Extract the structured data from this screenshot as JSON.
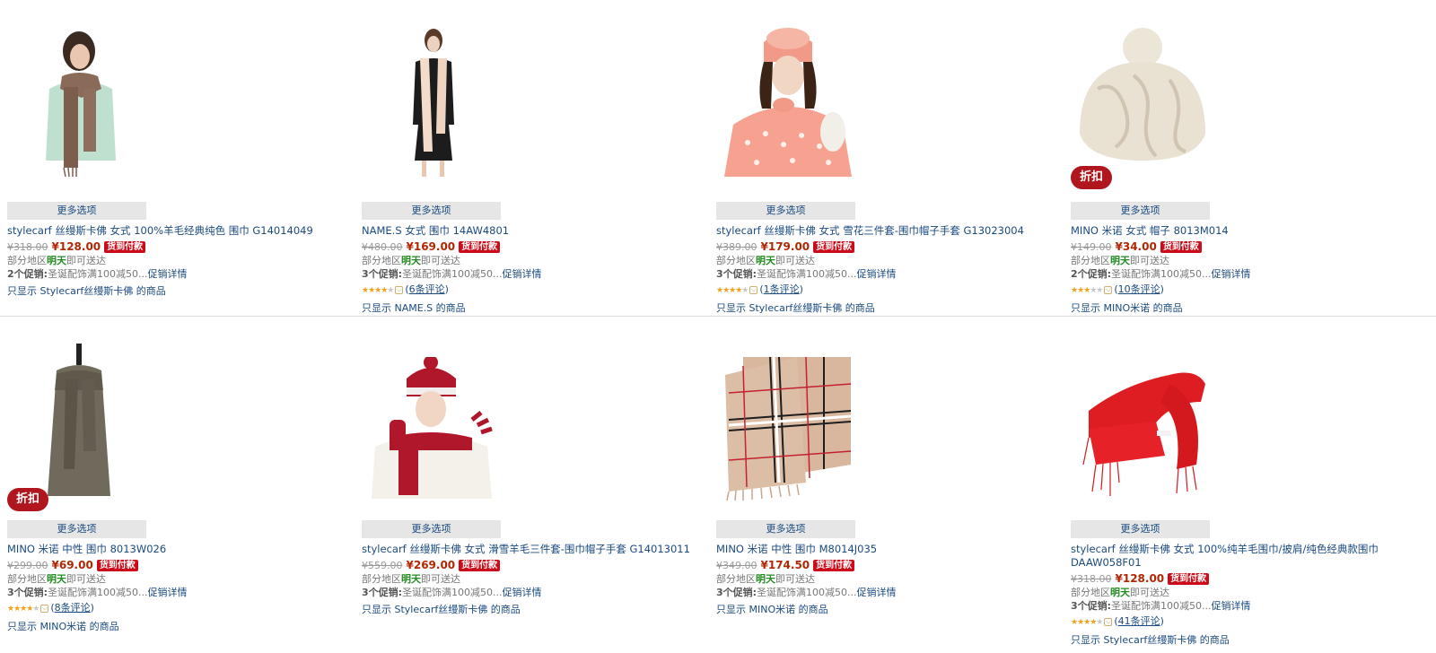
{
  "common": {
    "more_options": "更多选项",
    "cod": "货到付款",
    "delivery_prefix": "部分地区",
    "delivery_tomorrow": "明天",
    "delivery_suffix": "即可送达",
    "promo_text": "圣诞配饰满100减50...",
    "promo_link": "促销详情",
    "discount_badge": "折扣",
    "chev": "⌵"
  },
  "products": [
    {
      "title": "stylecarf 丝缦斯卡佛 女式 100%羊毛经典纯色 围巾 G14014049",
      "old_price": "¥318.00",
      "new_price": "¥128.00",
      "promo_count": "2个促销:",
      "reviews": null,
      "brand_filter": "只显示 Stylecarf丝缦斯卡佛 的商品",
      "discount": false
    },
    {
      "title": "NAME.S 女式 围巾 14AW4801",
      "old_price": "¥480.00",
      "new_price": "¥169.00",
      "promo_count": "3个促销:",
      "reviews": "6条评论",
      "brand_filter": "只显示 NAME.S 的商品",
      "discount": false
    },
    {
      "title": "stylecarf 丝缦斯卡佛 女式 雪花三件套-围巾帽子手套 G13023004",
      "old_price": "¥389.00",
      "new_price": "¥179.00",
      "promo_count": "3个促销:",
      "reviews": "1条评论",
      "brand_filter": "只显示 Stylecarf丝缦斯卡佛 的商品",
      "discount": false
    },
    {
      "title": "MINO 米诺 女式 帽子 8013M014",
      "old_price": "¥149.00",
      "new_price": "¥34.00",
      "promo_count": "2个促销:",
      "reviews": "10条评论",
      "brand_filter": "只显示 MINO米诺 的商品",
      "discount": true
    },
    {
      "title": "MINO 米诺 中性 围巾 8013W026",
      "old_price": "¥299.00",
      "new_price": "¥69.00",
      "promo_count": "3个促销:",
      "reviews": "8条评论",
      "brand_filter": "只显示 MINO米诺 的商品",
      "discount": true
    },
    {
      "title": "stylecarf 丝缦斯卡佛 女式 滑雪羊毛三件套-围巾帽子手套 G14013011",
      "old_price": "¥559.00",
      "new_price": "¥269.00",
      "promo_count": "3个促销:",
      "reviews": null,
      "brand_filter": "只显示 Stylecarf丝缦斯卡佛 的商品",
      "discount": false
    },
    {
      "title": "MINO 米诺 中性 围巾 M8014J035",
      "old_price": "¥349.00",
      "new_price": "¥174.50",
      "promo_count": "3个促销:",
      "reviews": null,
      "brand_filter": "只显示 MINO米诺 的商品",
      "discount": false
    },
    {
      "title": "stylecarf 丝缦斯卡佛 女式 100%纯羊毛围巾/披肩/纯色经典款围巾 DAAW058F01",
      "old_price": "¥318.00",
      "new_price": "¥128.00",
      "promo_count": "3个促销:",
      "reviews": "41条评论",
      "brand_filter": "只显示 Stylecarf丝缦斯卡佛 的商品",
      "discount": false
    }
  ],
  "ratings": {
    "p1": "4.5 of 5",
    "p2": "4 of 5",
    "p3": "3.5 of 5",
    "p4": "4.5 of 5",
    "p7": "4 of 5"
  },
  "colors": {
    "link": "#1a4a7f",
    "price": "#b12704",
    "cod_badge": "#cc0c1a",
    "discount_badge": "#b0161e",
    "tomorrow": "#228b22",
    "star": "#f0a21b"
  },
  "icons": {
    "star": "star-icon",
    "chevron": "chevron-down-icon"
  }
}
